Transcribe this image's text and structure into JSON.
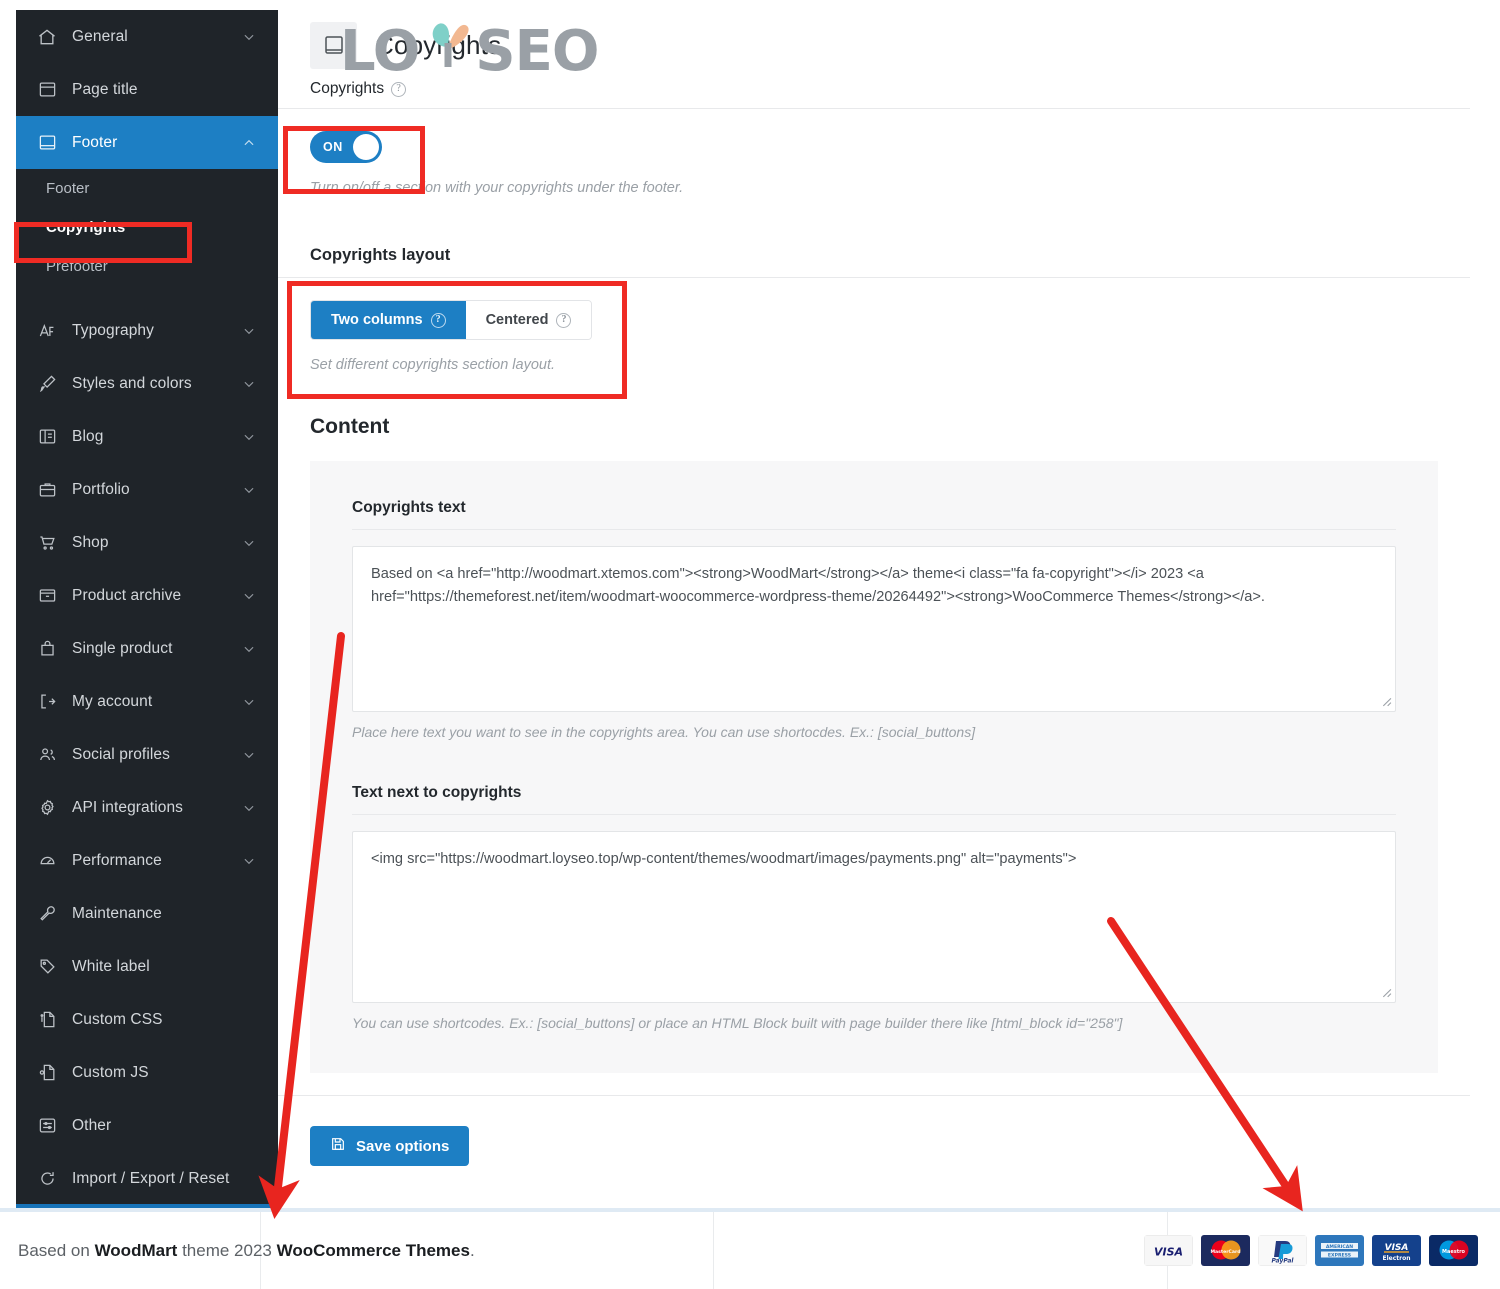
{
  "sidebar": {
    "items": [
      {
        "label": "General",
        "icon": "home-icon",
        "expandable": true,
        "state": "collapsed"
      },
      {
        "label": "Page title",
        "icon": "page-title-icon",
        "expandable": false,
        "state": ""
      },
      {
        "label": "Footer",
        "icon": "footer-icon",
        "expandable": true,
        "state": "expanded",
        "active": true
      }
    ],
    "footer_subitems": [
      {
        "label": "Footer",
        "current": false
      },
      {
        "label": "Copyrights",
        "current": true
      },
      {
        "label": "Prefooter",
        "current": false
      }
    ],
    "items_after": [
      {
        "label": "Typography",
        "icon": "typography-icon",
        "expandable": true
      },
      {
        "label": "Styles and colors",
        "icon": "brush-icon",
        "expandable": true
      },
      {
        "label": "Blog",
        "icon": "blog-icon",
        "expandable": true
      },
      {
        "label": "Portfolio",
        "icon": "briefcase-icon",
        "expandable": true
      },
      {
        "label": "Shop",
        "icon": "cart-icon",
        "expandable": true
      },
      {
        "label": "Product archive",
        "icon": "archive-icon",
        "expandable": true
      },
      {
        "label": "Single product",
        "icon": "bag-icon",
        "expandable": true
      },
      {
        "label": "My account",
        "icon": "account-icon",
        "expandable": true
      },
      {
        "label": "Social profiles",
        "icon": "users-icon",
        "expandable": true
      },
      {
        "label": "API integrations",
        "icon": "gear-icon",
        "expandable": true
      },
      {
        "label": "Performance",
        "icon": "gauge-icon",
        "expandable": true
      },
      {
        "label": "Maintenance",
        "icon": "wrench-icon",
        "expandable": false
      },
      {
        "label": "White label",
        "icon": "tag-icon",
        "expandable": false
      },
      {
        "label": "Custom CSS",
        "icon": "css-file-icon",
        "expandable": false
      },
      {
        "label": "Custom JS",
        "icon": "js-file-icon",
        "expandable": false
      },
      {
        "label": "Other",
        "icon": "sliders-icon",
        "expandable": false
      },
      {
        "label": "Import / Export / Reset",
        "icon": "refresh-icon",
        "expandable": false
      }
    ]
  },
  "header": {
    "title": "Copyrights",
    "icon": "book-icon",
    "logo_text_left": "LO",
    "logo_text_right": "SEO",
    "logo_color_teal": "#7fd0c8",
    "logo_color_peach": "#f2b891",
    "logo_color_grey": "#9aa0a6"
  },
  "copyrights_toggle": {
    "label": "Copyrights",
    "help_marker": "?",
    "state_label": "ON",
    "description": "Turn on/off a section with your copyrights under the footer.",
    "accent": "#1d7fc4"
  },
  "layout_section": {
    "title": "Copyrights layout",
    "options": [
      {
        "label": "Two columns",
        "selected": true,
        "help_marker": "?"
      },
      {
        "label": "Centered",
        "selected": false,
        "help_marker": "?"
      }
    ],
    "description": "Set different copyrights section layout."
  },
  "content_section": {
    "heading": "Content",
    "fields": [
      {
        "label": "Copyrights text",
        "value": "Based on <a href=\"http://woodmart.xtemos.com\"><strong>WoodMart</strong></a> theme<i class=\"fa fa-copyright\"></i> 2023 <a href=\"https://themeforest.net/item/woodmart-woocommerce-wordpress-theme/20264492\"><strong>WooCommerce Themes</strong></a>.",
        "help": "Place here text you want to see in the copyrights area. You can use shortocdes. Ex.: [social_buttons]"
      },
      {
        "label": "Text next to copyrights",
        "value": "<img src=\"https://woodmart.loyseo.top/wp-content/themes/woodmart/images/payments.png\" alt=\"payments\">",
        "help": "You can use shortcodes. Ex.: [social_buttons] or place an HTML Block built with page builder there like [html_block id=\"258\"]"
      }
    ]
  },
  "save": {
    "label": "Save options",
    "icon": "floppy-disk-icon"
  },
  "footer_preview": {
    "text_prefix": "Based on ",
    "brand1": "WoodMart",
    "text_mid": " theme 2023 ",
    "brand2": "WooCommerce Themes",
    "text_suffix": ".",
    "payments": [
      {
        "name": "visa-card-icon",
        "label": "VISA"
      },
      {
        "name": "mastercard-card-icon",
        "label": "MasterCard"
      },
      {
        "name": "paypal-card-icon",
        "label": "PayPal"
      },
      {
        "name": "amex-card-icon",
        "label": "AMERICAN EXPRESS"
      },
      {
        "name": "visa-electron-card-icon",
        "label": "VISA Electron"
      },
      {
        "name": "maestro-card-icon",
        "label": "Maestro"
      }
    ]
  },
  "annotations": {
    "highlight_color": "#ef2b24",
    "boxes": [
      {
        "name": "toggle-highlight"
      },
      {
        "name": "copyrights-menu-highlight"
      },
      {
        "name": "layout-highlight"
      }
    ],
    "arrows": [
      {
        "name": "arrow-to-copyrights-text"
      },
      {
        "name": "arrow-to-payments"
      }
    ]
  }
}
